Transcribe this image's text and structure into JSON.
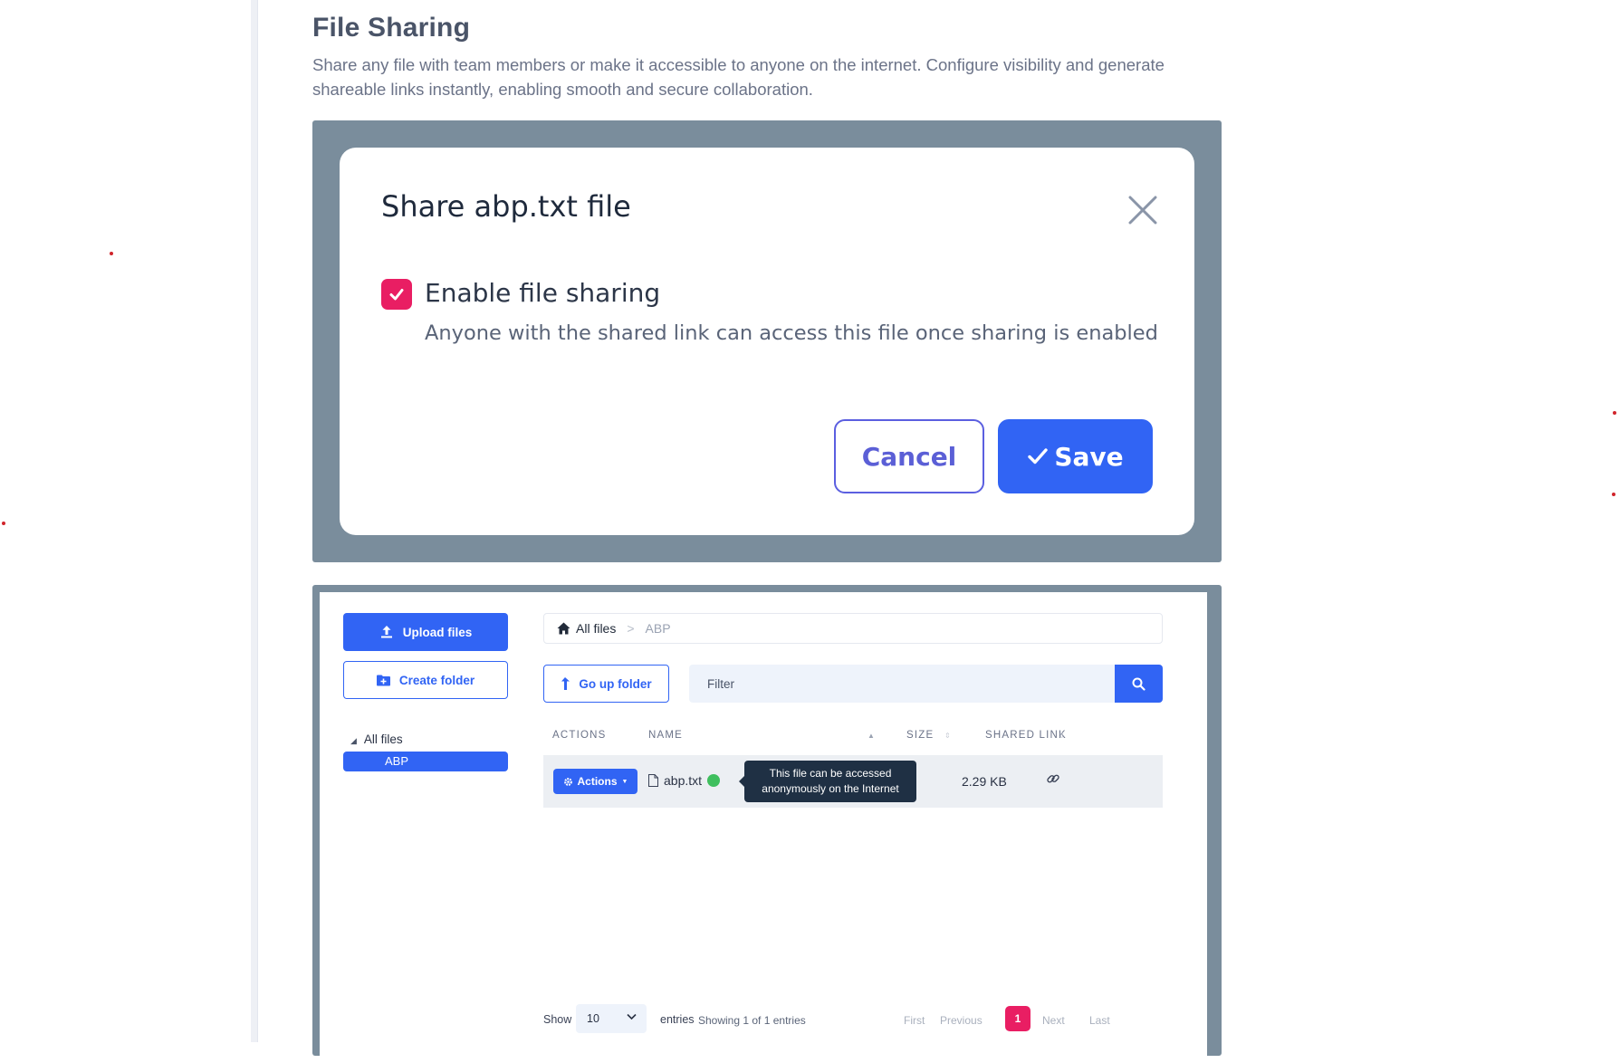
{
  "section": {
    "title": "File Sharing",
    "description": "Share any file with team members or make it accessible to anyone on the internet. Configure visibility and generate shareable links instantly, enabling smooth and secure collaboration."
  },
  "share_dialog": {
    "title": "Share abp.txt file",
    "checkbox_label": "Enable file sharing",
    "checkbox_checked": true,
    "help_text": "Anyone with the shared link can access this file once sharing is enabled",
    "cancel_label": "Cancel",
    "save_label": "Save",
    "accent_color": "#e91e63",
    "primary_color": "#3164f4"
  },
  "file_manager": {
    "upload_label": "Upload files",
    "create_folder_label": "Create folder",
    "tree": {
      "root": "All files",
      "selected": "ABP"
    },
    "breadcrumb": {
      "home": "All files",
      "current": "ABP"
    },
    "go_up_label": "Go up folder",
    "filter_placeholder": "Filter",
    "columns": [
      "ACTIONS",
      "NAME",
      "SIZE",
      "SHARED LINK"
    ],
    "rows": [
      {
        "actions_label": "Actions",
        "name": "abp.txt",
        "size": "2.29 KB",
        "shared": true
      }
    ],
    "tooltip": "This file can be accessed anonymously on the Internet",
    "footer": {
      "show_label": "Show",
      "page_size": "10",
      "entries_label": "entries",
      "info": "Showing 1 of 1 entries",
      "first": "First",
      "previous": "Previous",
      "current_page": "1",
      "next": "Next",
      "last": "Last"
    }
  }
}
